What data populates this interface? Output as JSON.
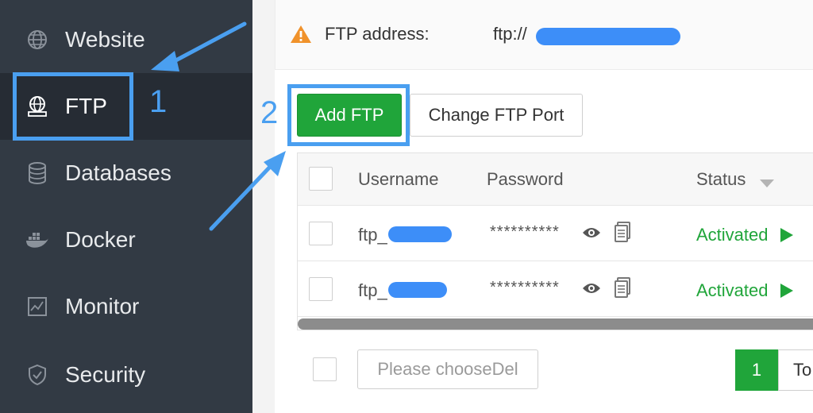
{
  "sidebar": {
    "items": [
      {
        "label": "Website",
        "icon": "globe-icon"
      },
      {
        "label": "FTP",
        "icon": "ftp-server-icon",
        "active": true
      },
      {
        "label": "Databases",
        "icon": "database-icon"
      },
      {
        "label": "Docker",
        "icon": "docker-icon"
      },
      {
        "label": "Monitor",
        "icon": "monitor-chart-icon"
      },
      {
        "label": "Security",
        "icon": "shield-icon"
      }
    ]
  },
  "ftp_info": {
    "label": "FTP address:",
    "value_prefix": "ftp://"
  },
  "toolbar": {
    "add_label": "Add FTP",
    "port_label": "Change FTP Port"
  },
  "table": {
    "columns": [
      "Username",
      "Password",
      "Status"
    ],
    "rows": [
      {
        "username_prefix": "ftp_",
        "password": "**********",
        "status": "Activated"
      },
      {
        "username_prefix": "ftp_",
        "password": "**********",
        "status": "Activated"
      }
    ]
  },
  "footer": {
    "delete_placeholder": "Please chooseDel",
    "page_current": "1",
    "page_next_partial": "To"
  },
  "annotations": {
    "step1": "1",
    "step2": "2"
  },
  "colors": {
    "accent_green": "#20a53a",
    "highlight_blue": "#4a9ff0",
    "sidebar_bg": "#323a44",
    "warning_orange": "#f0922b"
  }
}
